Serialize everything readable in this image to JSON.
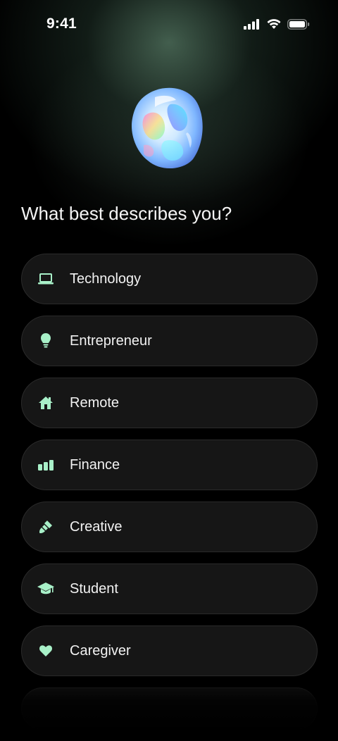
{
  "status_bar": {
    "time": "9:41"
  },
  "heading": "What best describes you?",
  "accent_color": "#a8f0c8",
  "options": [
    {
      "label": "Technology",
      "icon": "laptop-icon"
    },
    {
      "label": "Entrepreneur",
      "icon": "lightbulb-icon"
    },
    {
      "label": "Remote",
      "icon": "home-icon"
    },
    {
      "label": "Finance",
      "icon": "bar-chart-icon"
    },
    {
      "label": "Creative",
      "icon": "paintbrush-icon"
    },
    {
      "label": "Student",
      "icon": "graduation-cap-icon"
    },
    {
      "label": "Caregiver",
      "icon": "heart-icon"
    }
  ]
}
